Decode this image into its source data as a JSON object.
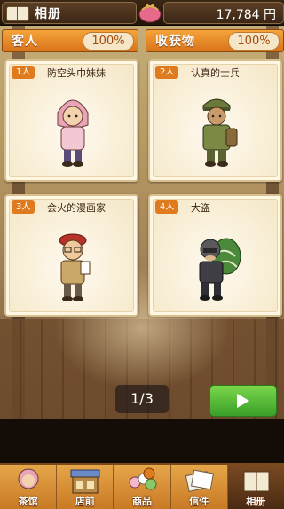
{
  "header": {
    "title": "相册",
    "coins": "17,784 円"
  },
  "stats": {
    "guests_label": "客人",
    "guests_pct": "100%",
    "harvest_label": "收获物",
    "harvest_pct": "100%"
  },
  "cards": [
    {
      "tag": "1人",
      "name": "防空头巾妹妹",
      "icon": "girl-hood-icon"
    },
    {
      "tag": "2人",
      "name": "认真的士兵",
      "icon": "soldier-icon"
    },
    {
      "tag": "3人",
      "name": "会火的漫画家",
      "icon": "manga-artist-icon"
    },
    {
      "tag": "4人",
      "name": "大盗",
      "icon": "thief-icon"
    }
  ],
  "pager": "1/3",
  "nav": {
    "items": [
      {
        "label": "茶馆",
        "icon": "teahouse-icon"
      },
      {
        "label": "店前",
        "icon": "storefront-icon"
      },
      {
        "label": "商品",
        "icon": "goods-icon"
      },
      {
        "label": "信件",
        "icon": "letters-icon"
      },
      {
        "label": "相册",
        "icon": "album-icon"
      }
    ]
  },
  "colors": {
    "accent": "#e07a1f",
    "next": "#4cb82e"
  }
}
